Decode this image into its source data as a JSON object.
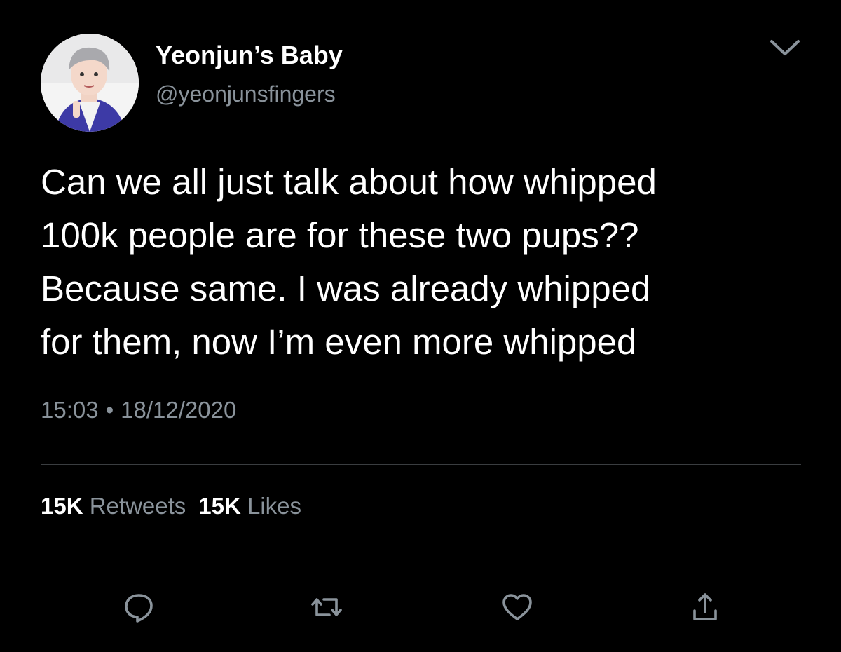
{
  "user": {
    "display_name": "Yeonjun’s Baby",
    "handle": "@yeonjunsfingers"
  },
  "tweet": {
    "lines": [
      "Can we all just talk about how whipped",
      "100k people are for these two pups??",
      "Because same. I was already whipped",
      "for them, now I’m even more whipped"
    ],
    "time": "15:03",
    "separator": "•",
    "date": "18/12/2020"
  },
  "stats": {
    "retweets_count": "15K",
    "retweets_label": "Retweets",
    "likes_count": "15K",
    "likes_label": "Likes"
  },
  "actions": [
    "reply-icon",
    "retweet-icon",
    "like-icon",
    "share-icon"
  ],
  "colors": {
    "background": "#000000",
    "text": "#ffffff",
    "secondary": "#8a939b",
    "divider": "#3a3d40",
    "avatar_jacket": "#3d3aa6"
  }
}
